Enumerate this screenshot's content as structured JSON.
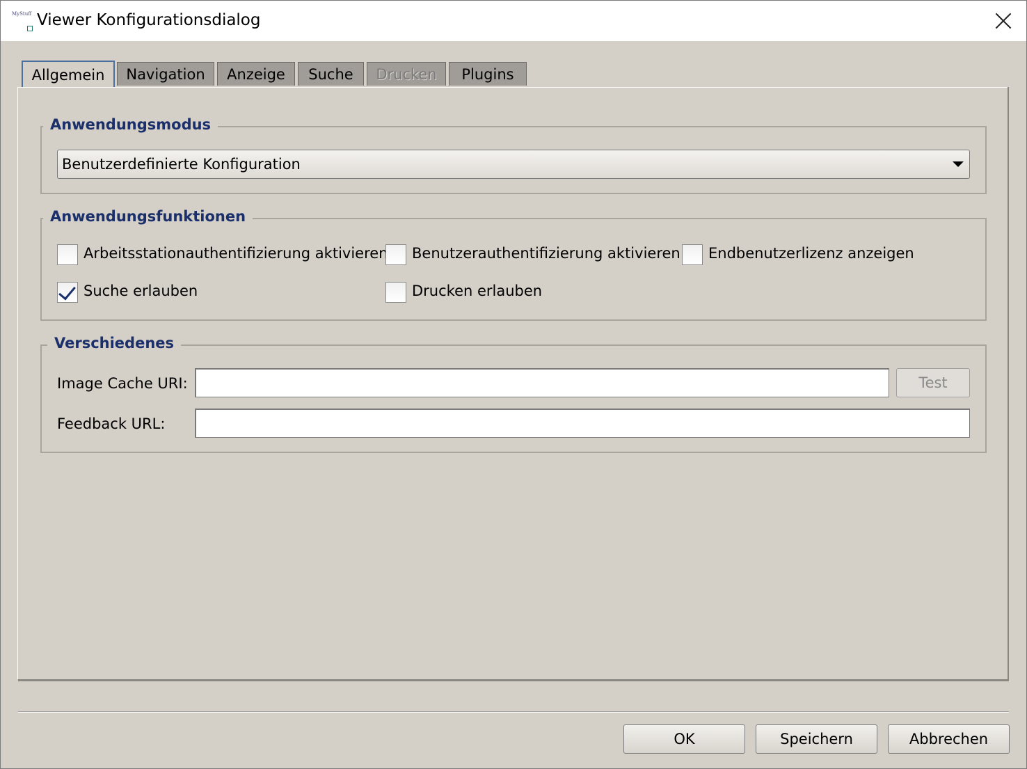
{
  "window": {
    "title": "Viewer Konfigurationsdialog"
  },
  "tabs": [
    {
      "label": "Allgemein",
      "active": true
    },
    {
      "label": "Navigation"
    },
    {
      "label": "Anzeige"
    },
    {
      "label": "Suche"
    },
    {
      "label": "Drucken",
      "disabled": true
    },
    {
      "label": "Plugins"
    }
  ],
  "mode_group": {
    "title": "Anwendungsmodus",
    "selected": "Benutzerdefinierte Konfiguration"
  },
  "functions_group": {
    "title": "Anwendungsfunktionen",
    "options": [
      {
        "label": "Arbeitsstationauthentifizierung aktivieren",
        "checked": false
      },
      {
        "label": "Benutzerauthentifizierung aktivieren",
        "checked": false
      },
      {
        "label": "Endbenutzerlizenz anzeigen",
        "checked": false
      },
      {
        "label": "Suche erlauben",
        "checked": true
      },
      {
        "label": "Drucken erlauben",
        "checked": false
      }
    ]
  },
  "misc_group": {
    "title": "Verschiedenes",
    "image_cache_label": "Image Cache URI:",
    "image_cache_value": "",
    "test_label": "Test",
    "feedback_label": "Feedback URL:",
    "feedback_value": ""
  },
  "footer": {
    "ok_label": "OK",
    "save_label": "Speichern",
    "cancel_label": "Abbrechen"
  }
}
